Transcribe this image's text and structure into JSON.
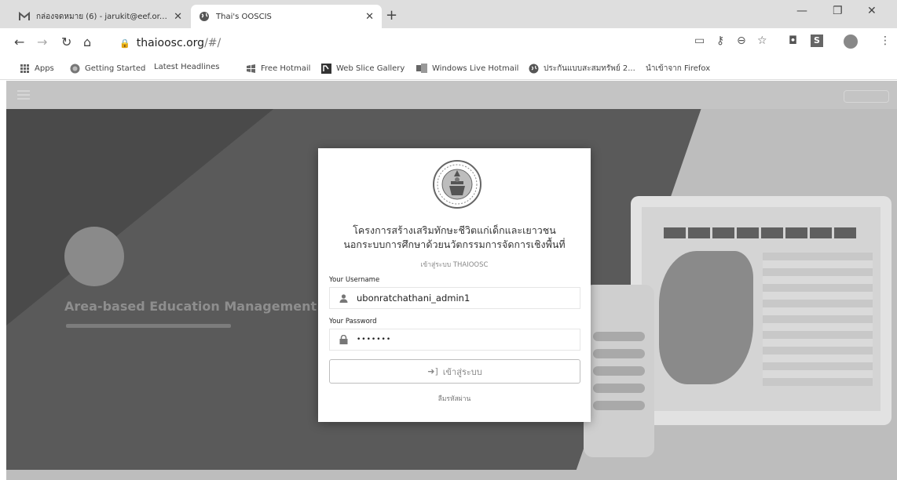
{
  "tabs": [
    {
      "title": "กล่องจดหมาย (6) - jarukit@eef.or.th -",
      "favicon": "gmail-icon"
    },
    {
      "title": "Thai's OOSCIS",
      "favicon": "globe-icon"
    }
  ],
  "toolbar": {
    "url_host": "thaioosc.org",
    "url_path": "/#/"
  },
  "bookmarks": {
    "apps": "Apps",
    "items": [
      "Getting Started",
      "Latest Headlines",
      "Free Hotmail",
      "Web Slice Gallery",
      "Windows Live Hotmail",
      "ประกันแบบสะสมทรัพย์ 2...",
      "นำเข้าจาก Firefox"
    ]
  },
  "modal": {
    "title_line1": "โครงการสร้างเสริมทักษะชีวิตแก่เด็กและเยาวชน",
    "title_line2": "นอกระบบการศึกษาด้วยนวัตกรรมการจัดการเชิงพื้นที่",
    "subtitle": "เข้าสู่ระบบ THAIOOSC",
    "username_label": "Your Username",
    "username_value": "ubonratchathani_admin1",
    "password_label": "Your Password",
    "password_value": "•••••••",
    "login_label": "เข้าสู่ระบบ",
    "forgot_label": "ลืมรหัสผ่าน"
  },
  "background": {
    "hero_title": "Area-based Education Management"
  }
}
